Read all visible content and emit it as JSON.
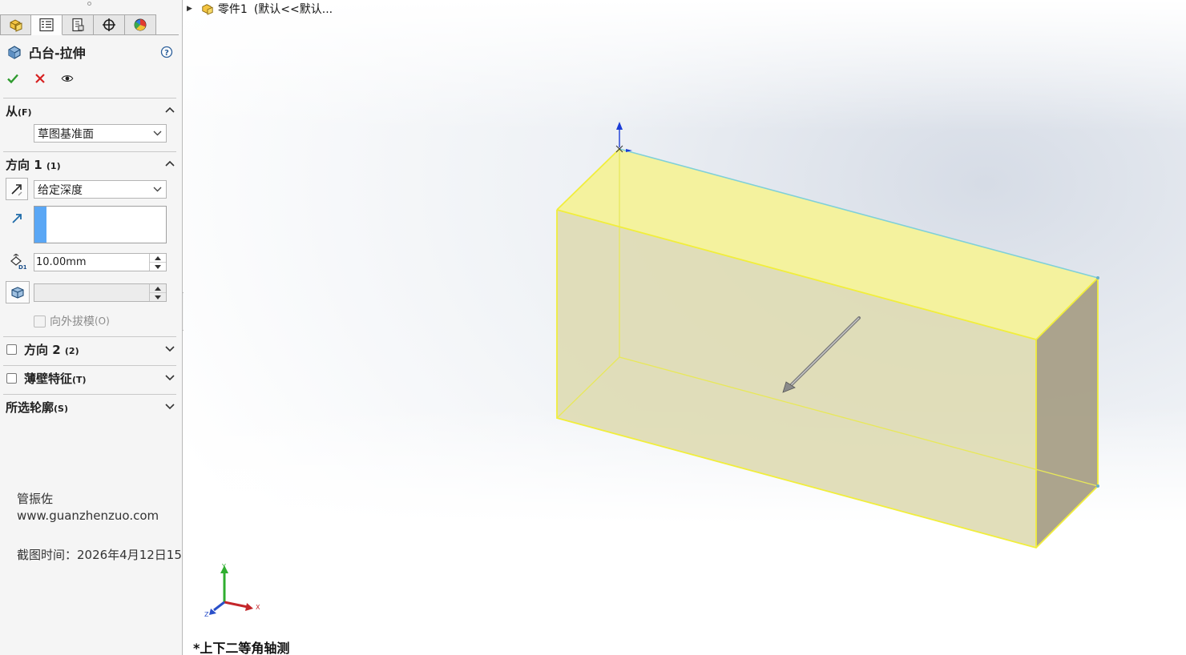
{
  "panel": {
    "tabs": [
      {
        "name": "feature-manager-tab",
        "icon": "part-icon",
        "active": false
      },
      {
        "name": "property-manager-tab",
        "icon": "property-list-icon",
        "active": true
      },
      {
        "name": "configuration-manager-tab",
        "icon": "configuration-icon",
        "active": false
      },
      {
        "name": "dimxpert-manager-tab",
        "icon": "crosshair-icon",
        "active": false
      },
      {
        "name": "display-manager-tab",
        "icon": "appearance-pie-icon",
        "active": false
      }
    ],
    "title": "凸台-拉伸",
    "actions": {
      "ok": "ok-check-icon",
      "cancel": "cancel-x-icon",
      "preview": "preview-eye-icon"
    },
    "from": {
      "title": "从",
      "key": "(F)",
      "start_condition": "草图基准面"
    },
    "direction1": {
      "title": "方向 1",
      "key": "(1)",
      "end_condition": "给定深度",
      "depth": "10.00mm",
      "draft_angle": "",
      "draft_outward_label": "向外拔模",
      "draft_outward_key": "(O)"
    },
    "direction2": {
      "title": "方向 2",
      "key": "(2)"
    },
    "thin_feature": {
      "title": "薄壁特征",
      "key": "(T)"
    },
    "selected_contours": {
      "title": "所选轮廓",
      "key": "(S)"
    }
  },
  "watermark": {
    "author": "管振佐",
    "site": "www.guanzhenzuo.com",
    "time": "截图时间：2026年4月12日15"
  },
  "viewport": {
    "tree_item": "零件1",
    "tree_config": "(默认<<默认...",
    "view_name": "*上下二等角轴测",
    "triad": {
      "x": "X",
      "y": "Y",
      "z": "Z"
    },
    "colors": {
      "preview_fill": "#f3f19a",
      "preview_edge": "#f2f24a",
      "side_face": "#a89f87"
    }
  }
}
